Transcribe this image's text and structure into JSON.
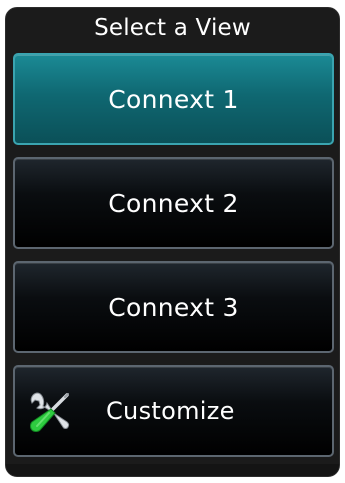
{
  "dialog": {
    "title": "Select a View",
    "options": [
      {
        "label": "Connext 1",
        "selected": true
      },
      {
        "label": "Connext 2",
        "selected": false
      },
      {
        "label": "Connext 3",
        "selected": false
      }
    ],
    "customize": {
      "label": "Customize",
      "icon": "wrench-screwdriver-icon"
    }
  },
  "colors": {
    "panel_bg": "#1b1b1b",
    "selected_button": "#0f6872",
    "selected_border": "#3aa4b0",
    "button_border": "#5c6670",
    "screwdriver_handle": "#2ecc40"
  }
}
